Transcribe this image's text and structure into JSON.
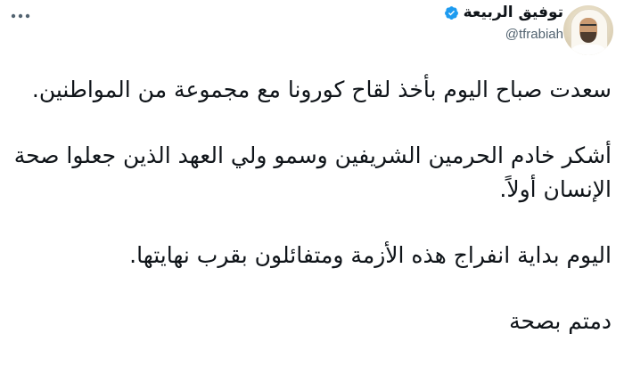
{
  "author": {
    "display_name": "توفيق الربيعة",
    "handle": "@tfrabiah",
    "verified": true,
    "avatar_icon": "profile-photo",
    "verified_icon": "verified-badge-icon",
    "verified_color": "#1d9bf0"
  },
  "menu": {
    "icon": "more-horizontal-icon"
  },
  "tweet": {
    "paragraphs": [
      "سعدت صباح اليوم بأخذ لقاح كورونا مع مجموعة من المواطنين.",
      "أشكر خادم الحرمين الشريفين وسمو ولي العهد الذين جعلوا صحة الإنسان أولاً.",
      "اليوم بداية انفراج هذه الأزمة ومتفائلون بقرب نهايتها.",
      "دمتم بصحة"
    ]
  },
  "colors": {
    "text": "#0f1419",
    "secondary_text": "#536471",
    "background": "#ffffff"
  }
}
